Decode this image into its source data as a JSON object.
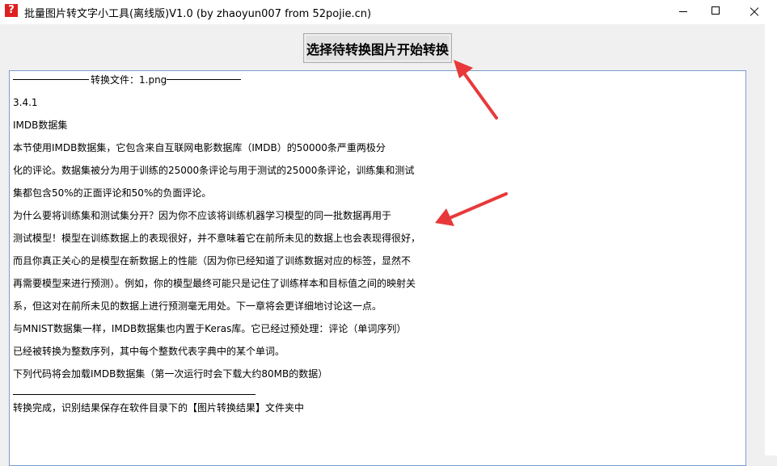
{
  "window": {
    "app_icon": "?",
    "title": "批量图片转文字小工具(离线版)V1.0  (by zhaoyun007 from 52pojie.cn)"
  },
  "toolbar": {
    "convert_label": "选择待转换图片开始转换"
  },
  "output": {
    "header_label": "转换文件：1.png",
    "lines": [
      "3.4.1",
      "IMDB数据集",
      "本节使用IMDB数据集，它包含来自互联网电影数据库（IMDB）的50000条严重两极分",
      "化的评论。数据集被分为用于训练的25000条评论与用于测试的25000条评论，训练集和测试",
      "集都包含50%的正面评论和50%的负面评论。",
      "为什么要将训练集和测试集分开？因为你不应该将训练机器学习模型的同一批数据再用于",
      "测试模型！模型在训练数据上的表现很好，并不意味着它在前所未见的数据上也会表现得很好，",
      "而且你真正关心的是模型在新数据上的性能（因为你已经知道了训练数据对应的标签，显然不",
      "再需要模型来进行预测）。例如，你的模型最终可能只是记住了训练样本和目标值之间的映射关",
      "系，但这对在前所未见的数据上进行预测毫无用处。下一章将会更详细地讨论这一点。",
      "与MNIST数据集一样，IMDB数据集也内置于Keras库。它已经过预处理：评论（单词序列）",
      "已经被转换为整数序列，其中每个整数代表字典中的某个单词。",
      "下列代码将会加载IMDB数据集（第一次运行时会下载大约80MB的数据）"
    ],
    "status": "转换完成，识别结果保存在软件目录下的【图片转换结果】文件夹中"
  },
  "annotations": {
    "arrow_color": "#e8393a"
  }
}
